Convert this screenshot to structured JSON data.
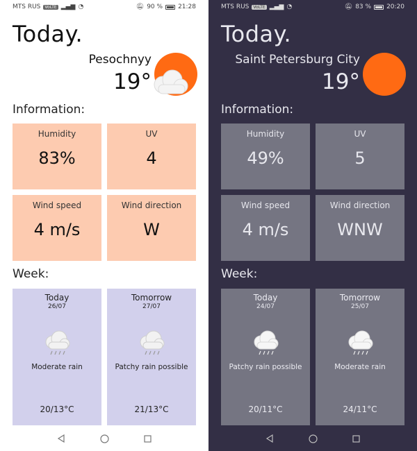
{
  "light": {
    "status": {
      "carrier": "MTS RUS",
      "tag": "VoLTE",
      "battery": "90 %",
      "time": "21:28"
    },
    "title": "Today.",
    "location": "Pesochnyy",
    "temperature": "19°",
    "info_heading": "Information:",
    "info": {
      "humidity_label": "Humidity",
      "humidity": "83%",
      "uv_label": "UV",
      "uv": "4",
      "wind_speed_label": "Wind speed",
      "wind_speed": "4 m/s",
      "wind_dir_label": "Wind direction",
      "wind_dir": "W"
    },
    "week_heading": "Week:",
    "days": [
      {
        "name": "Today",
        "date": "26/07",
        "condition": "Moderate rain",
        "temp": "20/13°C"
      },
      {
        "name": "Tomorrow",
        "date": "27/07",
        "condition": "Patchy rain possible",
        "temp": "21/13°C"
      }
    ]
  },
  "dark": {
    "status": {
      "carrier": "MTS RUS",
      "tag": "VoLTE",
      "battery": "83 %",
      "time": "20:20"
    },
    "title": "Today.",
    "location": "Saint Petersburg City",
    "temperature": "19°",
    "info_heading": "Information:",
    "info": {
      "humidity_label": "Humidity",
      "humidity": "49%",
      "uv_label": "UV",
      "uv": "5",
      "wind_speed_label": "Wind speed",
      "wind_speed": "4 m/s",
      "wind_dir_label": "Wind direction",
      "wind_dir": "WNW"
    },
    "week_heading": "Week:",
    "days": [
      {
        "name": "Today",
        "date": "24/07",
        "condition": "Patchy rain possible",
        "temp": "20/11°C"
      },
      {
        "name": "Tomorrow",
        "date": "25/07",
        "condition": "Moderate rain",
        "temp": "24/11°C"
      }
    ]
  },
  "colors": {
    "sun": "#ff6a13",
    "light_info_card": "#fdcbb0",
    "light_week_card": "#d2d0ec",
    "dark_bg": "#332f45",
    "dark_card": "#757582"
  }
}
